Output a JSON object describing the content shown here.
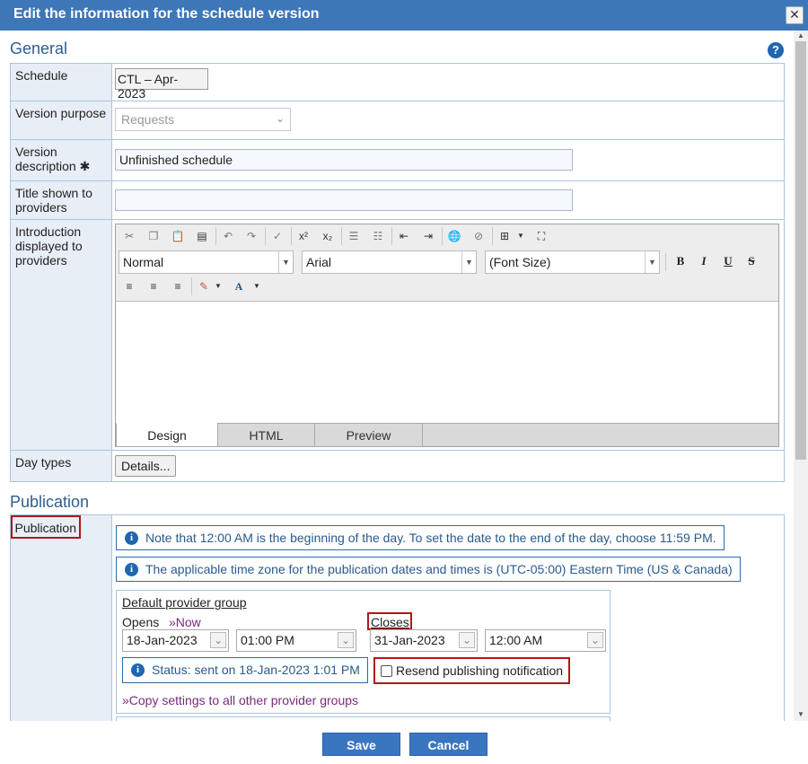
{
  "dialog": {
    "title": "Edit the information for the schedule version",
    "close_icon": "close-icon"
  },
  "general": {
    "title": "General",
    "help_icon": "help-icon",
    "schedule_label": "Schedule",
    "schedule_value": "CTL – Apr-2023",
    "version_purpose_label": "Version purpose",
    "version_purpose_value": "Requests",
    "version_description_label": "Version description",
    "required_star": "✱",
    "version_description_value": "Unfinished schedule",
    "title_shown_label": "Title shown to providers",
    "title_shown_value": "",
    "intro_label": "Introduction displayed to providers",
    "day_types_label": "Day types",
    "details_button": "Details..."
  },
  "editor": {
    "style_select": "Normal",
    "font_select": "Arial",
    "size_select": "(Font Size)",
    "bold": "B",
    "italic": "I",
    "underline": "U",
    "strike": "S",
    "tabs": [
      "Design",
      "HTML",
      "Preview"
    ],
    "active_tab": "Design"
  },
  "publication": {
    "title": "Publication",
    "label": "Publication",
    "note1": "Note that 12:00 AM is the beginning of the day. To set the date to the end of the day, choose 11:59 PM.",
    "note2": "The applicable time zone for the publication dates and times is (UTC-05:00) Eastern Time (US & Canada)",
    "group_title": "Default provider group",
    "opens_label": "Opens",
    "now_link": "»Now",
    "closes_label": "Closes",
    "open_date": "18-Jan-2023",
    "open_time": "01:00 PM",
    "close_date": "31-Jan-2023",
    "close_time": "12:00 AM",
    "status": "Status: sent on 18-Jan-2023 1:01 PM",
    "resend_label": "Resend publishing notification",
    "resend_checked": false,
    "copy_link": "»Copy settings to all other provider groups"
  },
  "footer": {
    "save": "Save",
    "cancel": "Cancel"
  },
  "colors": {
    "title_bar": "#3d77b8",
    "primary_button": "#3a76c0",
    "highlight_border": "#b01818",
    "info_border": "#2f6aa8"
  }
}
